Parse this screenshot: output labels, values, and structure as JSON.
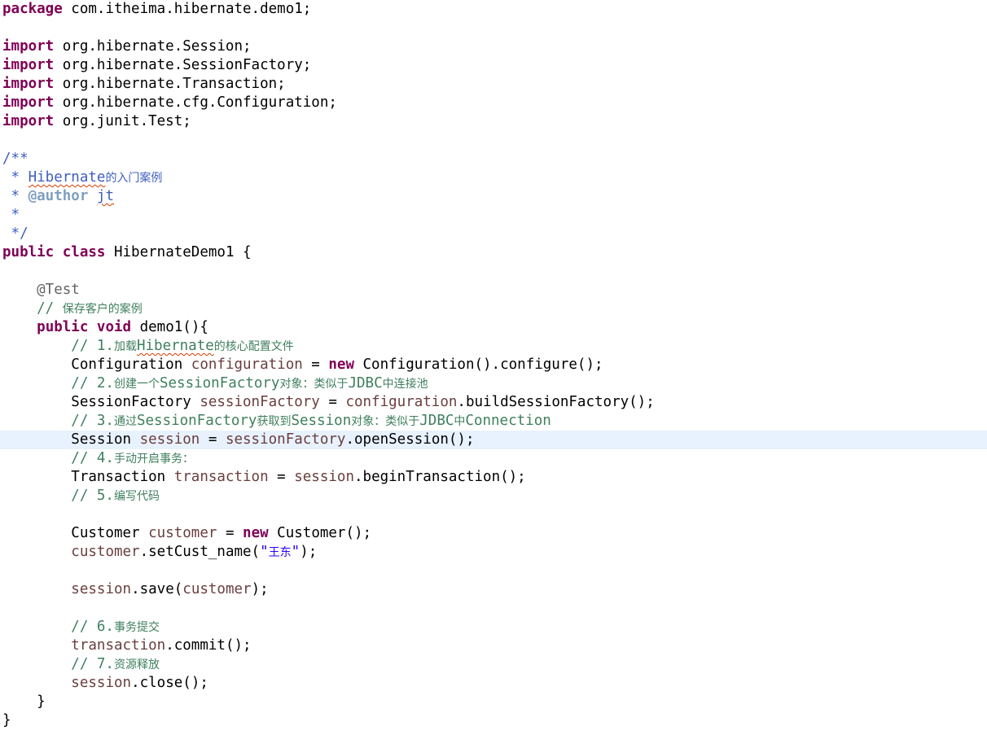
{
  "editor": {
    "lines": {
      "l01": [
        "package",
        " com.itheima.hibernate.demo1;"
      ],
      "l03": [
        "import",
        " org.hibernate.Session;"
      ],
      "l04": [
        "import",
        " org.hibernate.SessionFactory;"
      ],
      "l05": [
        "import",
        " org.hibernate.Transaction;"
      ],
      "l06": [
        "import",
        " org.hibernate.cfg.Configuration;"
      ],
      "l07": [
        "import",
        " org.junit.Test;"
      ],
      "l09": [
        "/**"
      ],
      "l10": [
        " * ",
        "Hibernate",
        "的入门案例"
      ],
      "l11": [
        " * ",
        "@author",
        " ",
        "jt"
      ],
      "l12": [
        " *"
      ],
      "l13": [
        " */"
      ],
      "l14": [
        "public",
        " ",
        "class",
        " HibernateDemo1 {"
      ],
      "l16": [
        "    @Test"
      ],
      "l17": [
        "    // ",
        "保存客户的案例"
      ],
      "l18": [
        "    ",
        "public",
        " ",
        "void",
        " demo1(){"
      ],
      "l19": [
        "        // 1.",
        "加载",
        "Hibernate",
        "的核心配置文件"
      ],
      "l20": [
        "        Configuration ",
        "configuration",
        " = ",
        "new",
        " Configuration().configure();"
      ],
      "l21": [
        "        // 2.",
        "创建一个",
        "SessionFactory",
        "对象：类似于",
        "JDBC",
        "中连接池"
      ],
      "l22": [
        "        SessionFactory ",
        "sessionFactory",
        " = ",
        "configuration",
        ".buildSessionFactory();"
      ],
      "l23": [
        "        // 3.",
        "通过",
        "SessionFactory",
        "获取到",
        "Session",
        "对象：类似于",
        "JDBC",
        "中",
        "Connection"
      ],
      "l24": [
        "        Session ",
        "session",
        " = ",
        "sessionFactory",
        ".openSession();"
      ],
      "l25": [
        "        // 4.",
        "手动开启事务："
      ],
      "l26": [
        "        Transaction ",
        "transaction",
        " = ",
        "session",
        ".beginTransaction();"
      ],
      "l27": [
        "        // 5.",
        "编写代码"
      ],
      "l29": [
        "        Customer ",
        "customer",
        " = ",
        "new",
        " Customer();"
      ],
      "l30": [
        "        ",
        "customer",
        ".setCust_name(",
        "\"",
        "王东",
        "\"",
        ");"
      ],
      "l32": [
        "        ",
        "session",
        ".save(",
        "customer",
        ");"
      ],
      "l34": [
        "        // 6.",
        "事务提交"
      ],
      "l35": [
        "        ",
        "transaction",
        ".commit();"
      ],
      "l36": [
        "        // 7.",
        "资源释放"
      ],
      "l37": [
        "        ",
        "session",
        ".close();"
      ],
      "l38": [
        "    }"
      ],
      "l39": [
        "}"
      ]
    }
  },
  "colors": {
    "keyword": "#7f0055",
    "comment": "#3f7f5f",
    "javadoc": "#3f5fbf",
    "javadoc_tag": "#7f9fbf",
    "annotation": "#646464",
    "local_variable": "#6a3e3e",
    "string": "#2a00ff",
    "current_line_highlight": "#e8f2fe"
  }
}
